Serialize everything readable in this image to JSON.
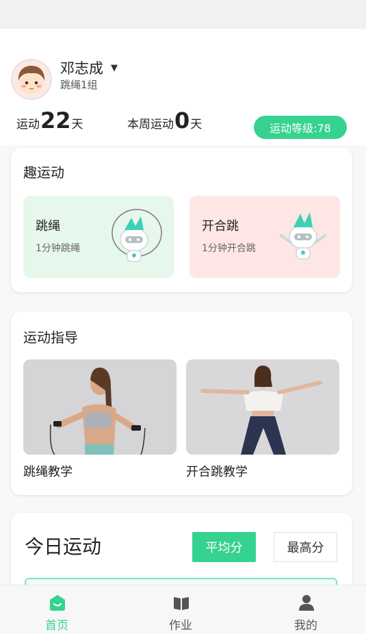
{
  "user": {
    "name": "邓志成",
    "group": "跳绳1组"
  },
  "stats": {
    "total_prefix": "运动",
    "total_days": "22",
    "total_suffix": "天",
    "week_prefix": "本周运动",
    "week_days": "0",
    "week_suffix": "天",
    "level_label": "运动等级:78"
  },
  "fun_section": {
    "title": "趣运动",
    "items": [
      {
        "title": "跳绳",
        "subtitle": "1分钟跳绳"
      },
      {
        "title": "开合跳",
        "subtitle": "1分钟开合跳"
      }
    ]
  },
  "guide_section": {
    "title": "运动指导",
    "items": [
      {
        "label": "跳绳教学"
      },
      {
        "label": "开合跳教学"
      }
    ]
  },
  "today_section": {
    "title": "今日运动",
    "buttons": {
      "average": "平均分",
      "max": "最高分"
    }
  },
  "tabbar": {
    "items": [
      {
        "label": "首页",
        "icon": "home-icon",
        "active": true
      },
      {
        "label": "作业",
        "icon": "book-icon",
        "active": false
      },
      {
        "label": "我的",
        "icon": "user-icon",
        "active": false
      }
    ]
  },
  "colors": {
    "accent": "#36d28f",
    "fun_tile_green": "#e6f7ec",
    "fun_tile_pink": "#fde6e3",
    "tab_inactive": "#555555"
  }
}
